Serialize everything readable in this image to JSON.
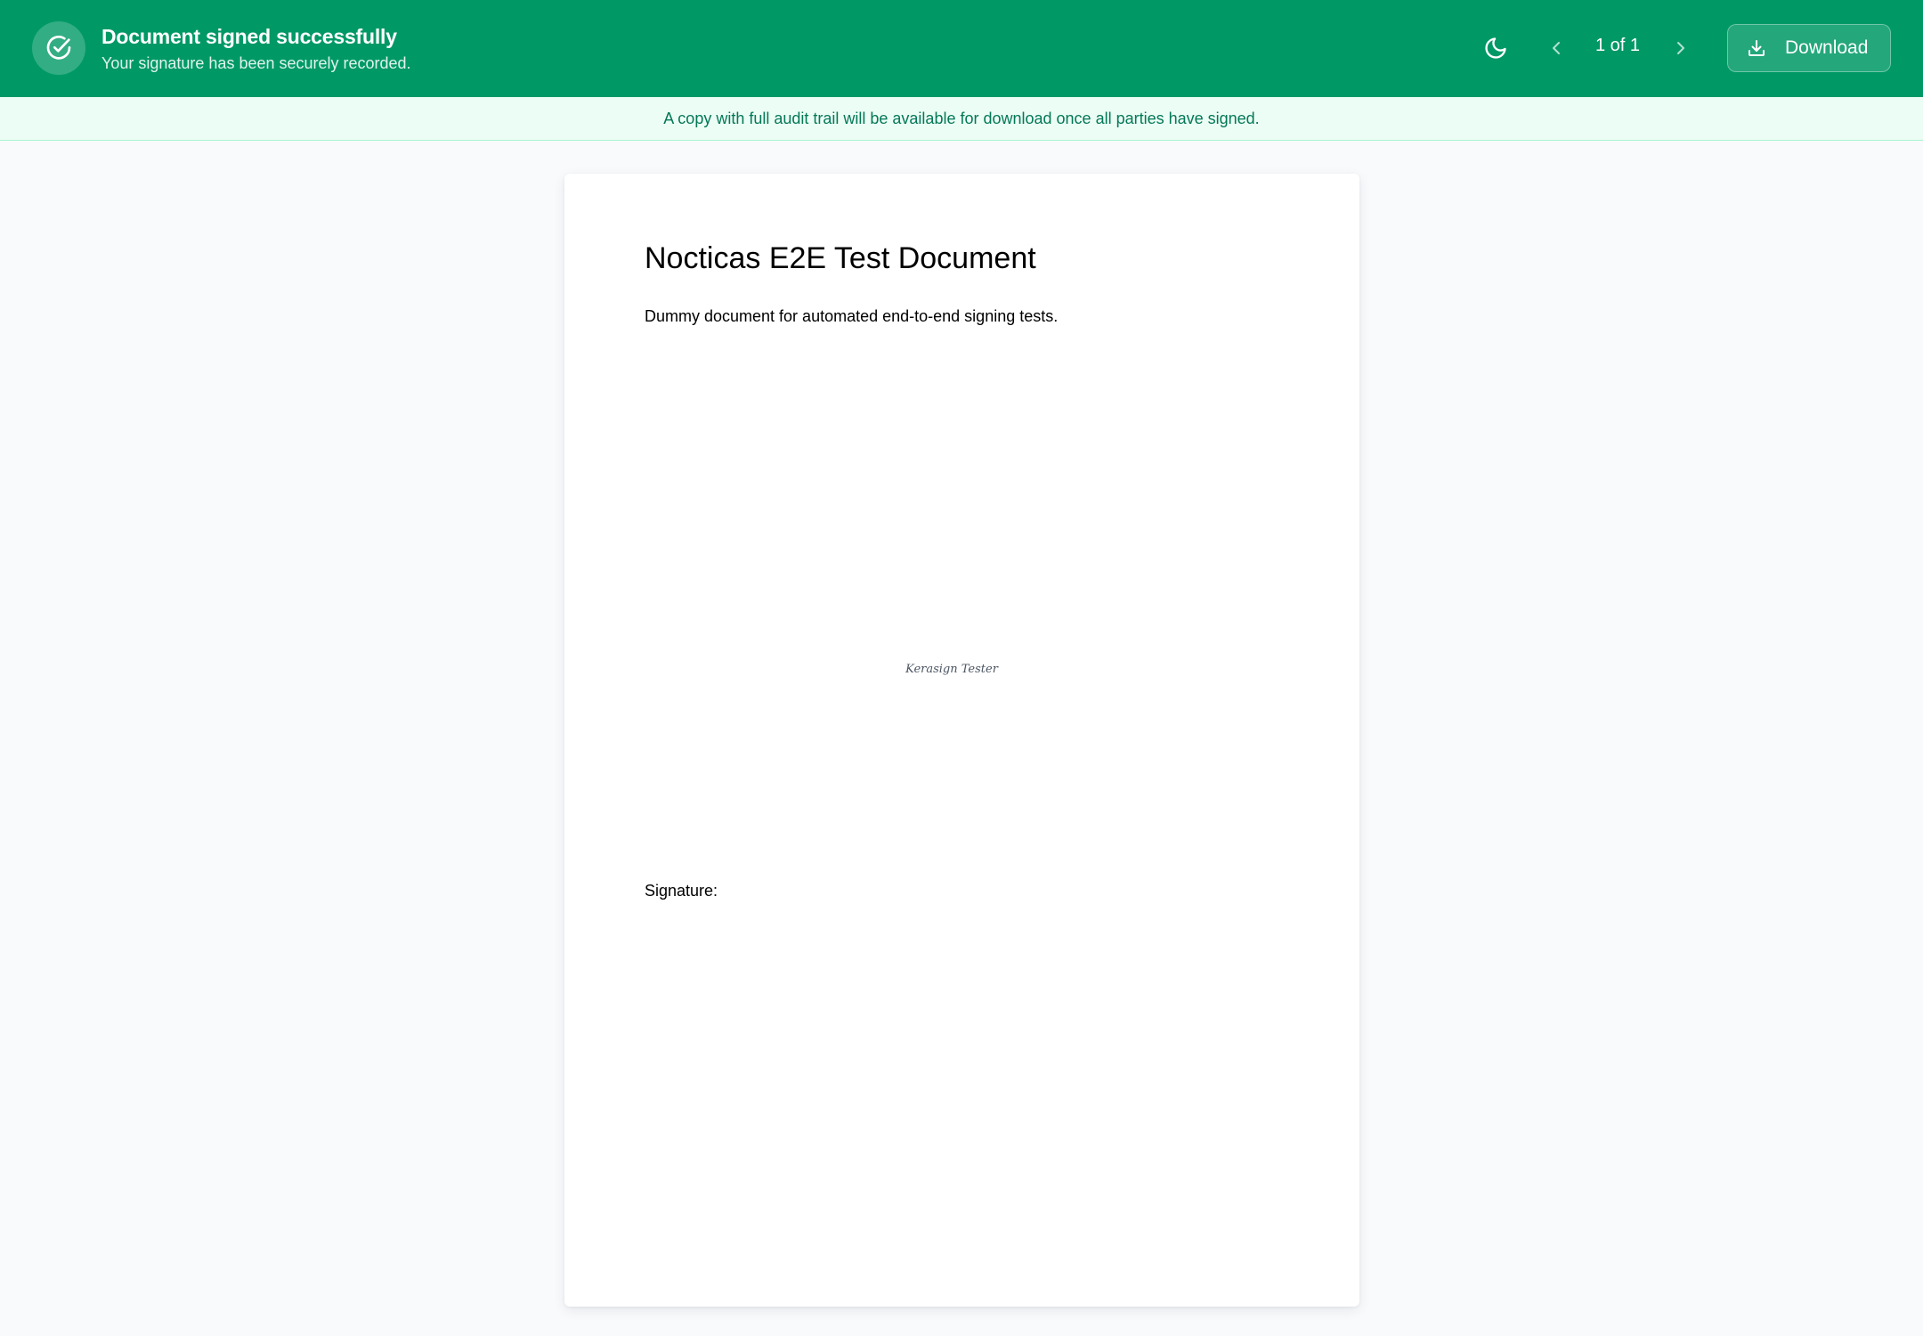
{
  "header": {
    "status_title": "Document signed successfully",
    "status_subtitle": "Your signature has been securely recorded.",
    "status_icon": "check-circle-icon",
    "theme_icon": "moon-icon",
    "pager": {
      "text": "1 of 1",
      "current_page": 1,
      "total_pages": 1,
      "prev_icon": "chevron-left-icon",
      "next_icon": "chevron-right-icon"
    },
    "download_label": "Download",
    "download_icon": "download-icon"
  },
  "notice": {
    "text": "A copy with full audit trail will be available for download once all parties have signed."
  },
  "document": {
    "title": "Nocticas E2E Test Document",
    "body": "Dummy document for automated end-to-end signing tests.",
    "signature_label": "Signature:",
    "signature_value": "Kerasign Tester"
  },
  "colors": {
    "header_bg": "#009966",
    "notice_bg": "#ecfdf5",
    "notice_text": "#047857",
    "page_bg": "#f8fafc",
    "document_bg": "#ffffff"
  }
}
